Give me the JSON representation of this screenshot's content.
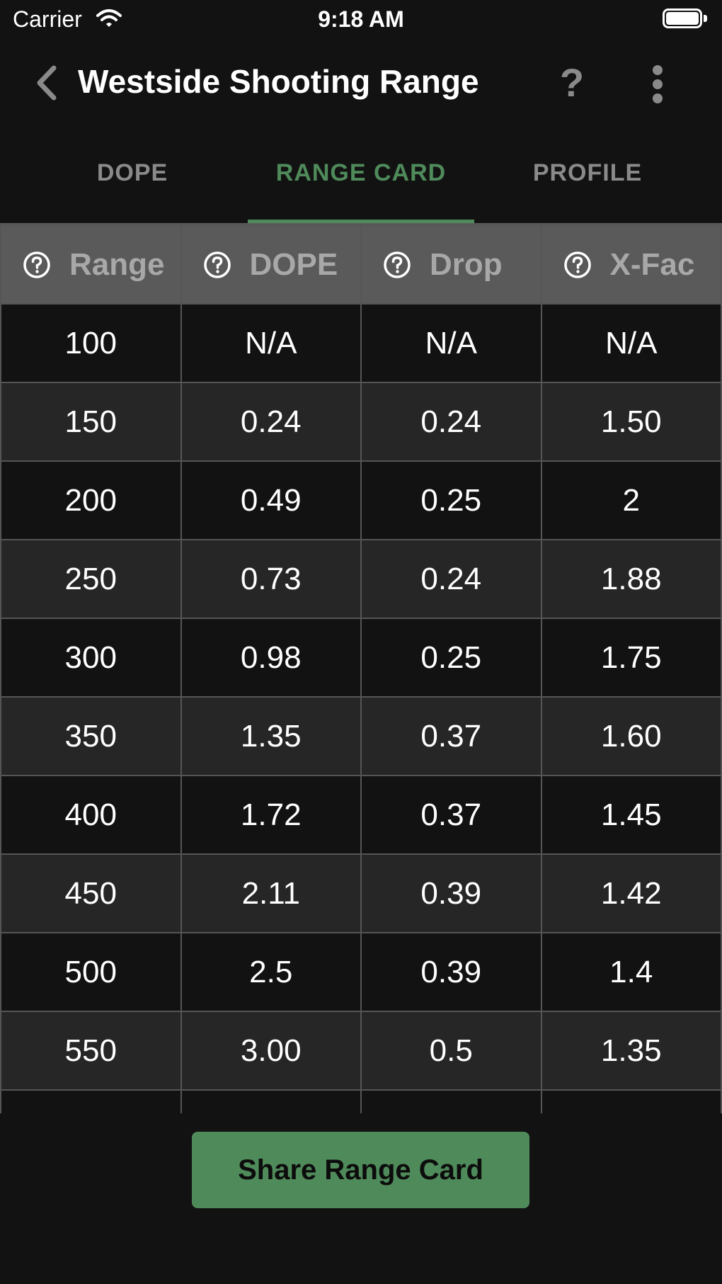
{
  "status_bar": {
    "carrier": "Carrier",
    "time": "9:18 AM",
    "wifi_icon": "wifi-icon",
    "battery_icon": "battery-full-icon"
  },
  "nav": {
    "back_icon": "chevron-left-icon",
    "title": "Westside Shooting Range",
    "help_label": "?",
    "more_icon": "vertical-ellipsis-icon"
  },
  "tabs": [
    {
      "label": "DOPE",
      "active": false
    },
    {
      "label": "RANGE CARD",
      "active": true
    },
    {
      "label": "PROFILE",
      "active": false
    }
  ],
  "table": {
    "help_icon": "question-circle-icon",
    "columns": [
      "Range",
      "DOPE",
      "Drop",
      "X-Fac"
    ],
    "rows": [
      [
        "100",
        "N/A",
        "N/A",
        "N/A"
      ],
      [
        "150",
        "0.24",
        "0.24",
        "1.50"
      ],
      [
        "200",
        "0.49",
        "0.25",
        "2"
      ],
      [
        "250",
        "0.73",
        "0.24",
        "1.88"
      ],
      [
        "300",
        "0.98",
        "0.25",
        "1.75"
      ],
      [
        "350",
        "1.35",
        "0.37",
        "1.60"
      ],
      [
        "400",
        "1.72",
        "0.37",
        "1.45"
      ],
      [
        "450",
        "2.11",
        "0.39",
        "1.42"
      ],
      [
        "500",
        "2.5",
        "0.39",
        "1.4"
      ],
      [
        "550",
        "3.00",
        "0.5",
        "1.35"
      ],
      [
        "",
        "",
        "",
        ""
      ]
    ]
  },
  "share_button": {
    "label": "Share Range Card"
  },
  "colors": {
    "background": "#121212",
    "accent": "#4f8a5a",
    "header_bg": "#5a5a5a",
    "row_alt": "#262626",
    "muted": "#8a8a8a"
  }
}
